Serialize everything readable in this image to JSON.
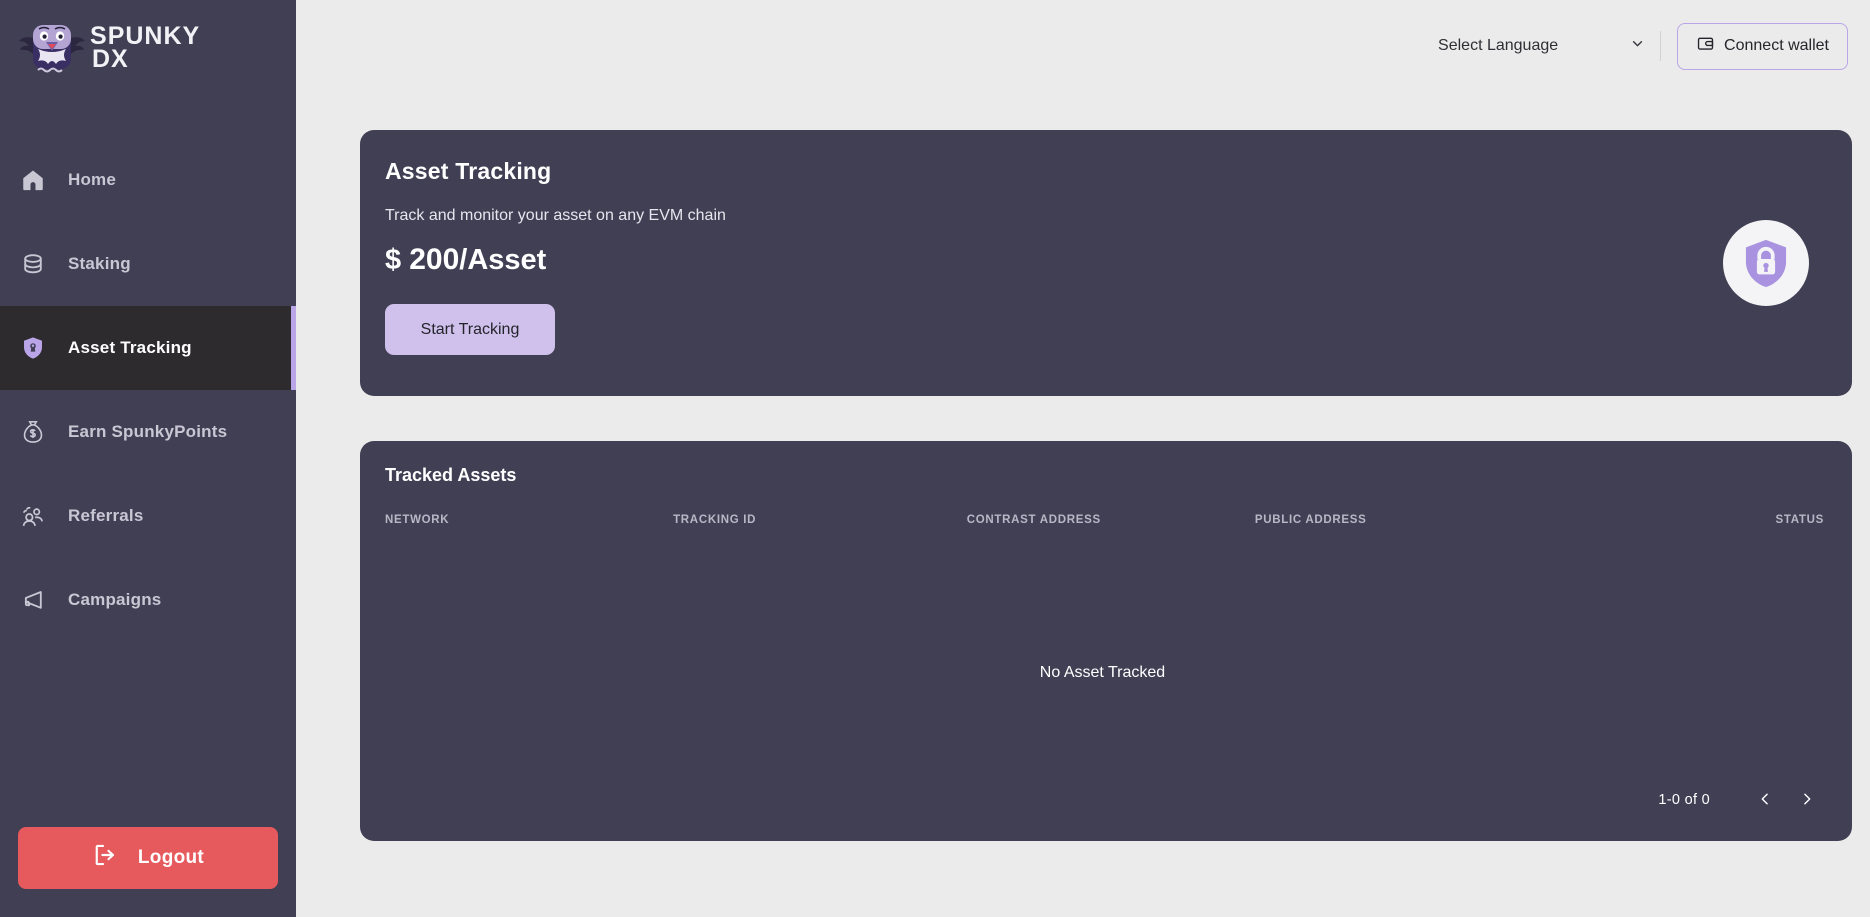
{
  "brand": {
    "line1": "PUNKY",
    "line2": "DX",
    "logo_icon": "spunky-mascot-logo"
  },
  "sidebar": {
    "items": [
      {
        "label": "Home",
        "icon": "home-icon",
        "active": false
      },
      {
        "label": "Staking",
        "icon": "database-stack-icon",
        "active": false
      },
      {
        "label": "Asset Tracking",
        "icon": "shield-lock-icon",
        "active": true
      },
      {
        "label": "Earn SpunkyPoints",
        "icon": "money-bag-icon",
        "active": false
      },
      {
        "label": "Referrals",
        "icon": "users-group-icon",
        "active": false
      },
      {
        "label": "Campaigns",
        "icon": "megaphone-icon",
        "active": false
      }
    ],
    "logout": {
      "label": "Logout",
      "icon": "logout-arrow-icon",
      "color": "#e65a5e"
    }
  },
  "topbar": {
    "language_selector": {
      "value": "Select Language",
      "chevron_icon": "chevron-down-icon"
    },
    "connect_wallet": {
      "label": "Connect wallet",
      "icon": "wallet-icon"
    }
  },
  "hero": {
    "title": "Asset Tracking",
    "subtitle": "Track and monitor your asset on any EVM chain",
    "price_currency": "$",
    "price_amount": "200",
    "price_unit": "/Asset",
    "cta_label": "Start Tracking",
    "badge_icon": "shield-padlock-icon",
    "accent_color": "#cfc0ec",
    "card_color": "#413f54"
  },
  "table": {
    "title": "Tracked Assets",
    "columns": [
      "NETWORK",
      "TRACKING ID",
      "CONTRAST ADDRESS",
      "PUBLIC ADDRESS",
      "STATUS"
    ],
    "rows": [],
    "empty_message": "No Asset Tracked",
    "pagination": {
      "range_label": "1-0 of 0",
      "prev_icon": "chevron-left-icon",
      "next_icon": "chevron-right-icon"
    }
  }
}
